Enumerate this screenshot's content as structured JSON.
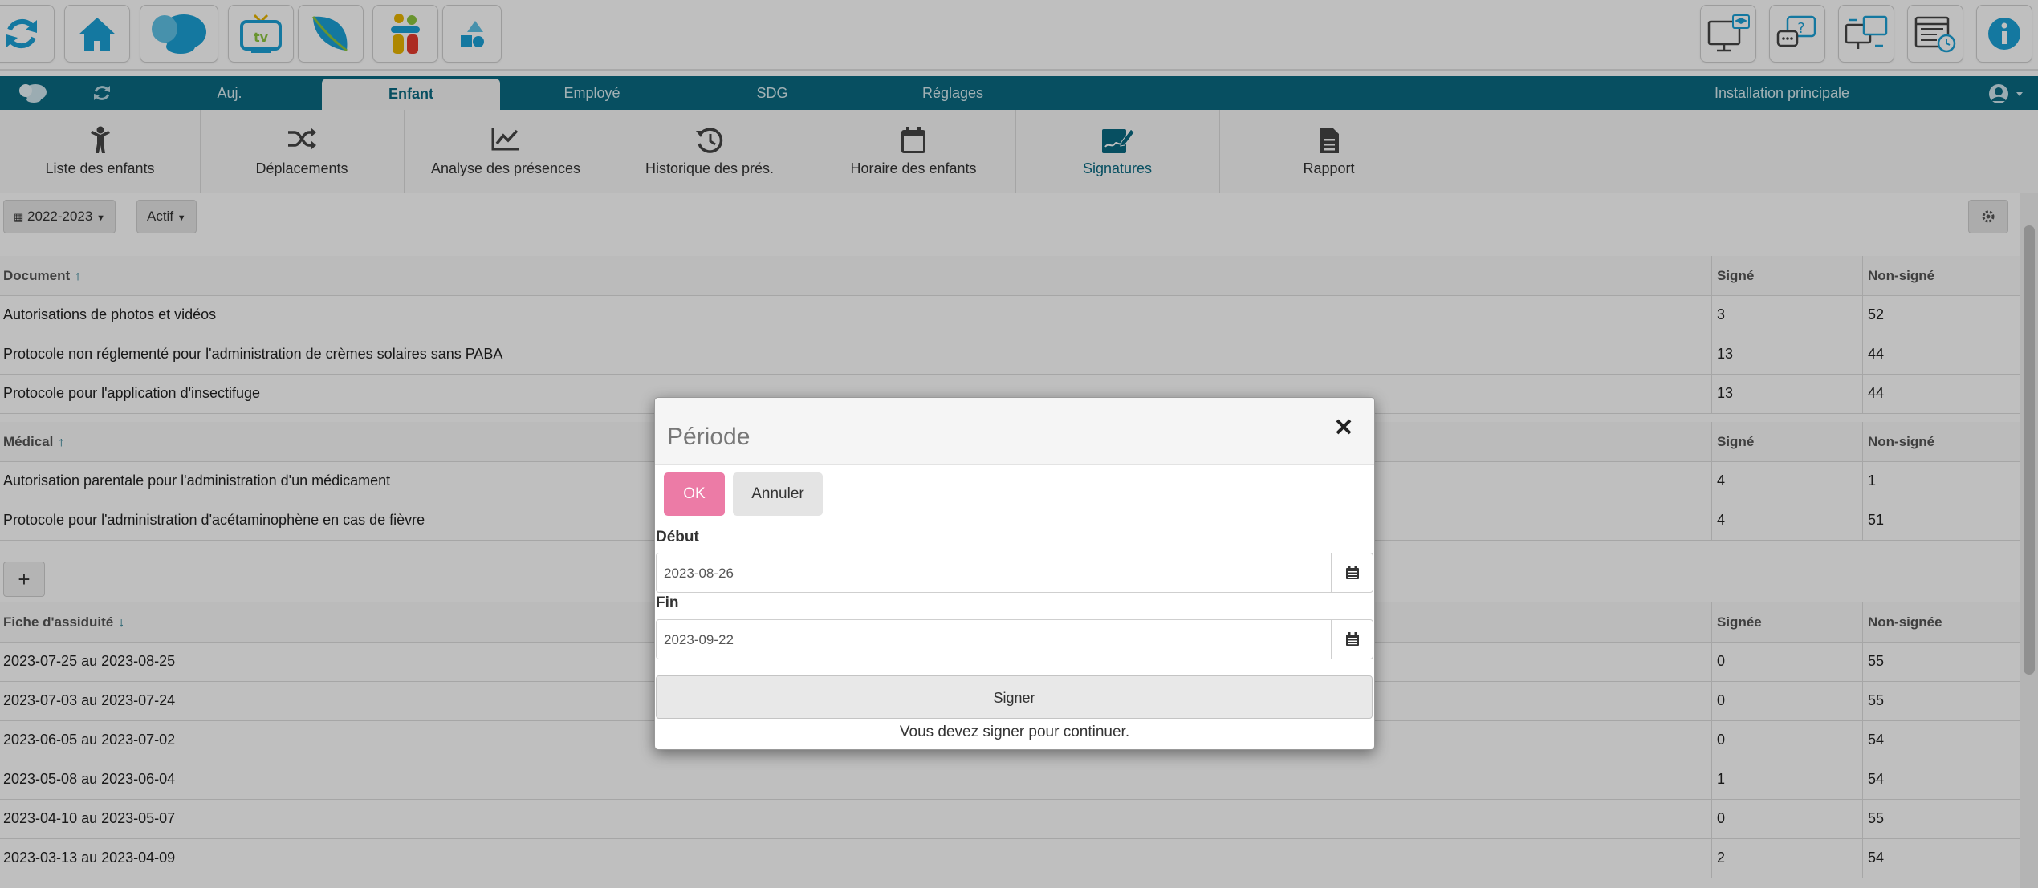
{
  "launcher": {
    "left_icons": [
      "refresh-icon",
      "home-icon",
      "butterfly-logo-icon",
      "tv-icon",
      "leaf-icon",
      "kids-icon",
      "shapes-icon"
    ],
    "right_icons": [
      "training-monitor-icon",
      "help-chat-icon",
      "remote-support-icon",
      "schedule-calendar-icon",
      "info-icon"
    ]
  },
  "navbar": {
    "tabs": [
      {
        "label": "Auj."
      },
      {
        "label": "Enfant"
      },
      {
        "label": "Employé"
      },
      {
        "label": "SDG"
      },
      {
        "label": "Réglages"
      }
    ],
    "location": "Installation principale",
    "active_tab": "Enfant"
  },
  "submenu": {
    "items": [
      {
        "label": "Liste des enfants",
        "icon": "child-icon"
      },
      {
        "label": "Déplacements",
        "icon": "shuffle-icon"
      },
      {
        "label": "Analyse des présences",
        "icon": "chart-icon"
      },
      {
        "label": "Historique des prés.",
        "icon": "history-icon"
      },
      {
        "label": "Horaire des enfants",
        "icon": "calendar-icon"
      },
      {
        "label": "Signatures",
        "icon": "signature-icon"
      },
      {
        "label": "Rapport",
        "icon": "document-icon"
      }
    ],
    "active": "Signatures"
  },
  "filters": {
    "year": "2022-2023",
    "status": "Actif"
  },
  "documents": {
    "header": {
      "name": "Document",
      "signed": "Signé",
      "unsigned": "Non-signé"
    },
    "rows": [
      {
        "name": "Autorisations de photos et vidéos",
        "signed": "3",
        "unsigned": "52"
      },
      {
        "name": "Protocole non réglementé pour l'administration de crèmes solaires sans PABA",
        "signed": "13",
        "unsigned": "44"
      },
      {
        "name": "Protocole pour l'application d'insectifuge",
        "signed": "13",
        "unsigned": "44"
      }
    ]
  },
  "medical": {
    "header": {
      "name": "Médical",
      "signed": "Signé",
      "unsigned": "Non-signé"
    },
    "rows": [
      {
        "name": "Autorisation parentale pour l'administration d'un médicament",
        "signed": "4",
        "unsigned": "1"
      },
      {
        "name": "Protocole pour l'administration d'acétaminophène en cas de fièvre",
        "signed": "4",
        "unsigned": "51"
      }
    ]
  },
  "add_button": "+",
  "attendance": {
    "header": {
      "name": "Fiche d'assiduité",
      "signed": "Signée",
      "unsigned": "Non-signée"
    },
    "rows": [
      {
        "name": "2023-07-25 au 2023-08-25",
        "signed": "0",
        "unsigned": "55"
      },
      {
        "name": "2023-07-03 au 2023-07-24",
        "signed": "0",
        "unsigned": "55"
      },
      {
        "name": "2023-06-05 au 2023-07-02",
        "signed": "0",
        "unsigned": "54"
      },
      {
        "name": "2023-05-08 au 2023-06-04",
        "signed": "1",
        "unsigned": "54"
      },
      {
        "name": "2023-04-10 au 2023-05-07",
        "signed": "0",
        "unsigned": "55"
      },
      {
        "name": "2023-03-13 au 2023-04-09",
        "signed": "2",
        "unsigned": "54"
      }
    ]
  },
  "modal": {
    "title": "Période",
    "ok_label": "OK",
    "cancel_label": "Annuler",
    "start_label": "Début",
    "start_value": "2023-08-26",
    "end_label": "Fin",
    "end_value": "2023-09-22",
    "sign_label": "Signer",
    "sign_message": "Vous devez signer pour continuer."
  },
  "colors": {
    "navbar": "#0a6a82",
    "ok_button": "#ec7ba6",
    "brand_blue": "#1ba1d6"
  }
}
